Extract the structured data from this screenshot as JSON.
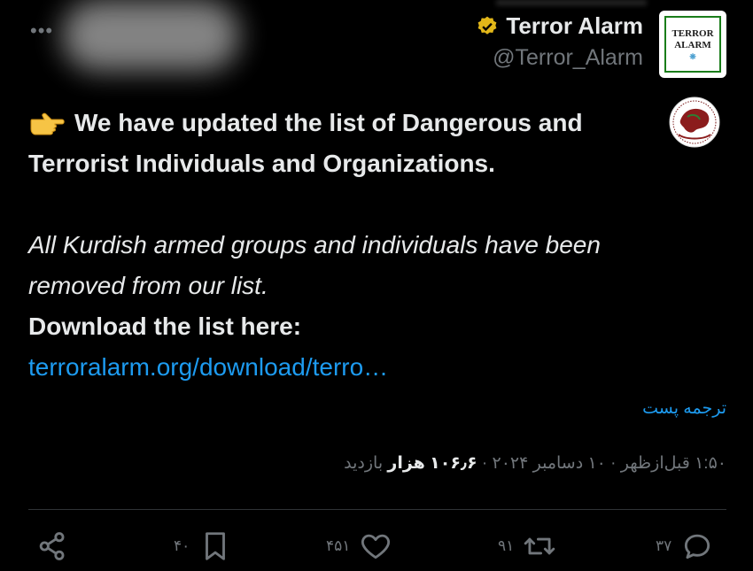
{
  "header": {
    "more_label": "•••",
    "display_name": "Terror Alarm",
    "handle": "@Terror_Alarm",
    "avatar_line1": "TERROR",
    "avatar_line2": "ALARM",
    "avatar_mark": "❋"
  },
  "tweet": {
    "line1": "We have updated the list of Dangerous and Terrorist Individuals and Organizations.",
    "line2": "All Kurdish armed groups and individuals have been removed from our list.",
    "line3": "Download the list here:",
    "link": "terroralarm.org/download/terro…"
  },
  "translate_label": "ترجمه پست",
  "meta": {
    "time": "۱:۵۰ قبل‌ازظهر",
    "sep1": " · ",
    "date": "۱۰ دسامبر ۲۰۲۴",
    "sep2": " · ",
    "views_count": "۱۰۶٫۶ هزار",
    "views_label": " بازدید"
  },
  "actions": {
    "reply_count": "۳۷",
    "retweet_count": "۹۱",
    "like_count": "۴۵۱",
    "bookmark_count": "۴۰"
  },
  "colors": {
    "background": "#000000",
    "text": "#e7e9ea",
    "muted": "#71767b",
    "link": "#1d9bf0",
    "verified_gold": "#e2b719"
  },
  "icons": [
    "verified-badge-icon",
    "pointing-right-emoji-icon",
    "kurdistan-map-logo-icon",
    "share-icon",
    "bookmark-icon",
    "like-icon",
    "retweet-icon",
    "reply-icon"
  ]
}
